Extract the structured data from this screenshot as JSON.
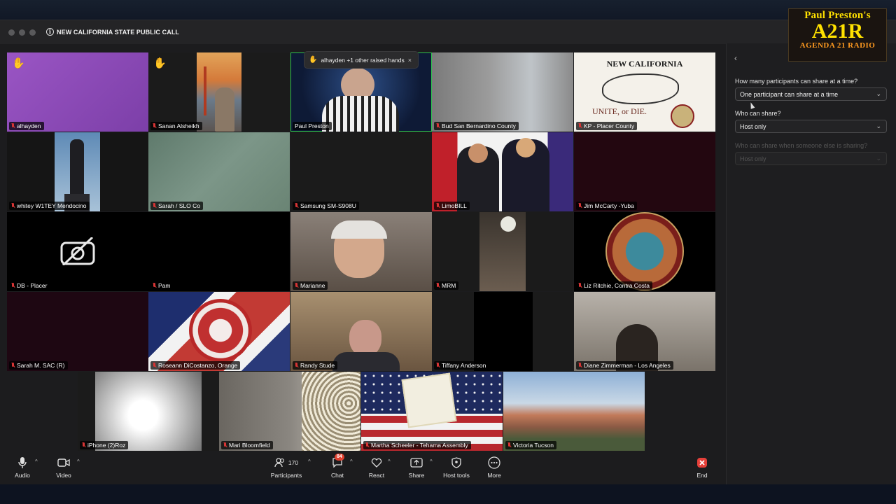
{
  "window": {
    "title": "NEW CALIFORNIA STATE PUBLIC CALL"
  },
  "raised_hands_popup": {
    "text": "alhayden +1 other raised hands",
    "close": "×"
  },
  "participants": [
    {
      "name": "alhayden",
      "hand": true
    },
    {
      "name": "Sanan Alsheikh",
      "hand": true
    },
    {
      "name": "Paul Preston",
      "hand": false,
      "active": true
    },
    {
      "name": "Bud  San Bernardino County",
      "hand": false
    },
    {
      "name": "KP - Placer County",
      "hand": false
    },
    {
      "name": "whitey  W1TEY Mendocino",
      "hand": false
    },
    {
      "name": "Sarah / SLO Co",
      "hand": false
    },
    {
      "name": "Samsung SM-S908U",
      "hand": false
    },
    {
      "name": "LimoBILL",
      "hand": false
    },
    {
      "name": "Jim McCarty -Yuba",
      "hand": false
    },
    {
      "name": "DB - Placer",
      "hand": false
    },
    {
      "name": "Pam",
      "hand": false
    },
    {
      "name": "Marianne",
      "hand": false
    },
    {
      "name": "MRM",
      "hand": false
    },
    {
      "name": "Liz Ritchie, Contra Costa",
      "hand": false
    },
    {
      "name": "Sarah M. SAC (R)",
      "hand": false
    },
    {
      "name": "Roseann DiCostanzo, Orange",
      "hand": false
    },
    {
      "name": "Randy Stude",
      "hand": false
    },
    {
      "name": "Tiffany  Anderson",
      "hand": false
    },
    {
      "name": "Diane Zimmerman - Los Angeles",
      "hand": false
    },
    {
      "name": "iPhone (2)Roz",
      "hand": false
    },
    {
      "name": "Mari Bloomfield",
      "hand": false
    },
    {
      "name": "Martha Scheeler - Tehama Assembly",
      "hand": false
    },
    {
      "name": "Victoria Tucson",
      "hand": false
    }
  ],
  "tiles_text": {
    "new_california": "NEW CALIFORNIA",
    "unite_or_die": "UNITE, or DIE."
  },
  "share_panel": {
    "q1": "How many participants can share at a time?",
    "q1_value": "One participant can share at a time",
    "q2": "Who can share?",
    "q2_value": "Host only",
    "q3": "Who can share when someone else is sharing?",
    "q3_value": "Host only"
  },
  "toolbar": {
    "audio": "Audio",
    "video": "Video",
    "participants": "Participants",
    "participants_count": "170",
    "chat": "Chat",
    "chat_badge": "84",
    "react": "React",
    "share": "Share",
    "host_tools": "Host tools",
    "more": "More",
    "end": "End"
  },
  "logo": {
    "line1": "Paul Preston's",
    "line2": "A21R",
    "line3": "AGENDA 21 RADIO"
  }
}
